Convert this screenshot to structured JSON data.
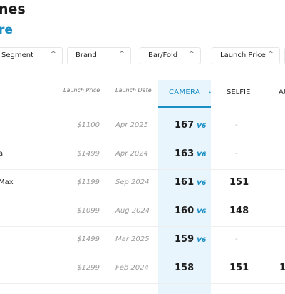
{
  "page": {
    "title": "nes",
    "subtitle": "re"
  },
  "filters": [
    {
      "label": "Segment"
    },
    {
      "label": "Brand"
    },
    {
      "label": "Bar/Fold"
    },
    {
      "label": "Launch Price"
    }
  ],
  "columns": {
    "launch_price": "Launch Price",
    "launch_date": "Launch Date",
    "camera": "CAMERA",
    "selfie": "SELFIE",
    "audio": "AU"
  },
  "rows": [
    {
      "name": "",
      "price": "$1100",
      "date": "Apr 2025",
      "camera": "167",
      "camera_badge": "V6",
      "selfie": "-",
      "audio": ""
    },
    {
      "name": "a",
      "price": "$1499",
      "date": "Apr 2024",
      "camera": "163",
      "camera_badge": "V6",
      "selfie": "-",
      "audio": ""
    },
    {
      "name": "Max",
      "price": "$1199",
      "date": "Sep 2024",
      "camera": "161",
      "camera_badge": "V6",
      "selfie": "151",
      "audio": ""
    },
    {
      "name": "",
      "price": "$1099",
      "date": "Aug 2024",
      "camera": "160",
      "camera_badge": "V6",
      "selfie": "148",
      "audio": ""
    },
    {
      "name": "",
      "price": "$1499",
      "date": "Mar 2025",
      "camera": "159",
      "camera_badge": "V6",
      "selfie": "-",
      "audio": ""
    },
    {
      "name": "",
      "price": "$1299",
      "date": "Feb 2024",
      "camera": "158",
      "camera_badge": "",
      "selfie": "151",
      "audio": "1"
    }
  ],
  "icons": {
    "filter_chevron": "chevron-up-icon",
    "next_column": "chevron-right-icon"
  },
  "colors": {
    "accent": "#1b8fc4",
    "camera_column_bg": "#e9f5fc"
  }
}
